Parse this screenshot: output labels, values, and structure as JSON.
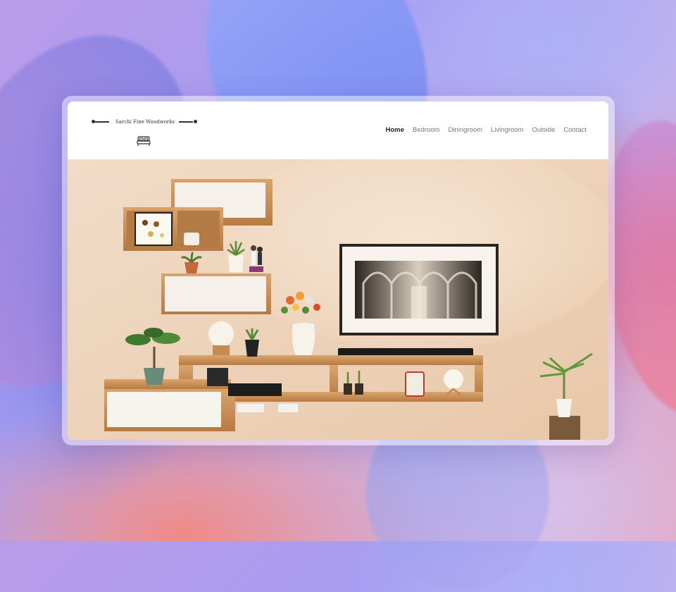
{
  "site": {
    "brand": "Sarchi Fine Woodworks",
    "brand_icon": "bed-icon"
  },
  "nav": {
    "items": [
      {
        "label": "Home",
        "active": true
      },
      {
        "label": "Bedroom",
        "active": false
      },
      {
        "label": "Diningroom",
        "active": false
      },
      {
        "label": "Livingroom",
        "active": false
      },
      {
        "label": "Outside",
        "active": false
      },
      {
        "label": "Contact",
        "active": false
      }
    ]
  },
  "hero": {
    "image": "living-room-floating-wooden-shelves-with-tv-artwork"
  },
  "colors": {
    "wall": "#ecd3bd",
    "wood": "#c98d55",
    "nav_active": "#222222",
    "nav_inactive": "#777777"
  }
}
